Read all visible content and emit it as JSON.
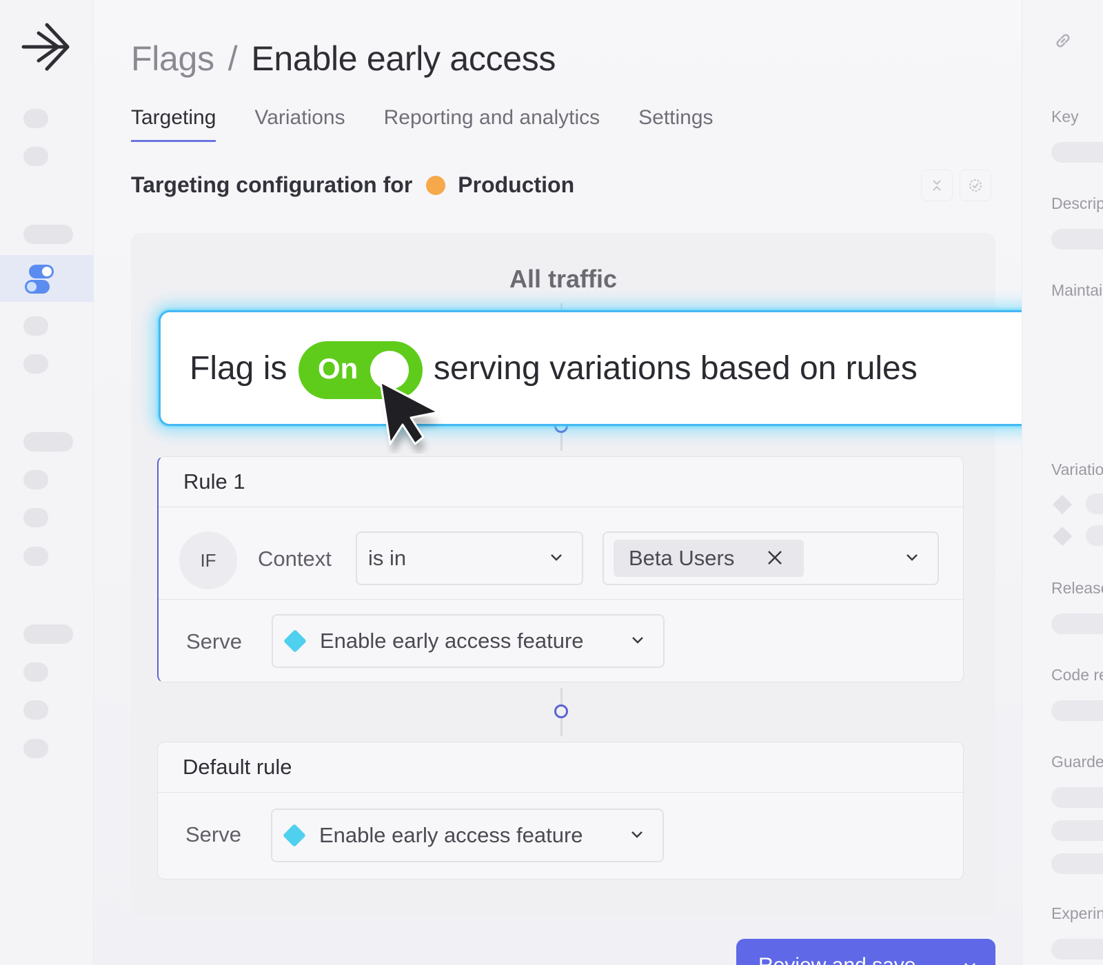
{
  "breadcrumb": {
    "root": "Flags",
    "separator": "/",
    "current": "Enable early access"
  },
  "tabs": [
    "Targeting",
    "Variations",
    "Reporting and analytics",
    "Settings"
  ],
  "active_tab": "Targeting",
  "targeting": {
    "heading": "Targeting configuration for",
    "environment": "Production",
    "environment_color": "#f6a84a"
  },
  "all_traffic": "All traffic",
  "flag_status": {
    "prefix": "Flag is",
    "state": "On",
    "suffix": "serving variations based on rules",
    "switch_color": "#5fcc1c",
    "highlight_color": "#44b8f2"
  },
  "rule1": {
    "title": "Rule 1",
    "if_label": "IF",
    "context_label": "Context",
    "operator": "is in",
    "chip": "Beta Users",
    "serve_label": "Serve",
    "serve_value": "Enable early access feature"
  },
  "default_rule": {
    "title": "Default rule",
    "serve_label": "Serve",
    "serve_value": "Enable early access feature"
  },
  "variation_color": "#4fd0ee",
  "right_panel": {
    "labels": [
      "Key",
      "Descrip",
      "Maintai",
      "Variatio",
      "Release",
      "Code re",
      "Guarde",
      "Experin"
    ]
  },
  "review_button": "Review and save",
  "accent_color": "#5f68e6"
}
